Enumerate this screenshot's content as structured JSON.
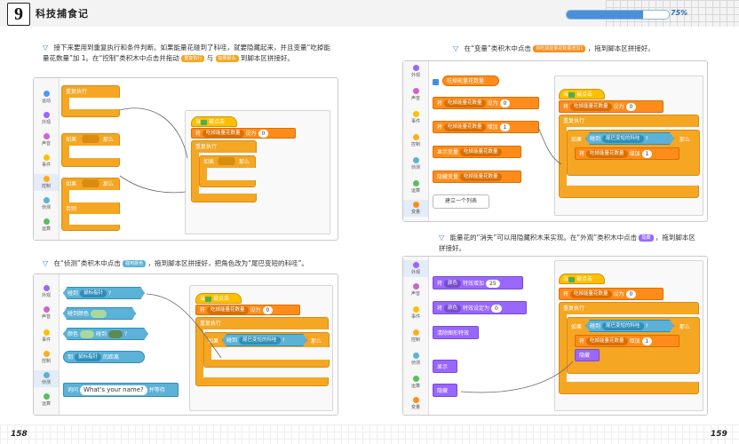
{
  "header": {
    "chapter_number": "9",
    "chapter_title": "科技捕食记",
    "progress_percent": 75,
    "progress_label": "75%"
  },
  "left_page": {
    "page_number": "158",
    "step1": {
      "text_a": "接下来要用到重复执行和条件判断。如果能量花碰到了科哇，就要隐藏起来，并且变量“吃掉能量花数量”加 1。在“控制”类积木中点击并拖动",
      "text_b": "与",
      "text_c": "到脚本区拼接好。",
      "chip1": "重复执行",
      "chip2": "如果那么"
    },
    "panel1": {
      "categories": [
        "运动",
        "外观",
        "声音",
        "事件",
        "控制",
        "侦测",
        "运算"
      ],
      "selected": "控制",
      "palette": {
        "repeat": "重复执行",
        "if": "如果",
        "then": "那么",
        "if2": "如果",
        "then2": "那么",
        "else": "否则"
      },
      "script": {
        "hat": "当",
        "hat_suffix": "被点击",
        "set_prefix": "将",
        "set_var": "吃掉能量花数量",
        "set_mid": "设为",
        "set_val": "0",
        "repeat": "重复执行",
        "if": "如果",
        "then": "那么"
      }
    },
    "step2": {
      "text_a": "在“侦测”类积木中点击",
      "chip": "碰到颜色",
      "text_b": "，拖到脚本区拼接好，把角色改为“尾巴变短的科哇”。"
    },
    "panel2": {
      "categories": [
        "外观",
        "声音",
        "事件",
        "控制",
        "侦测",
        "运算"
      ],
      "selected": "侦测",
      "palette": {
        "touching": "碰到",
        "touching_target": "鼠标指针",
        "touching_color": "碰到颜色",
        "color": "颜色",
        "color_touch": "碰到",
        "to": "到",
        "to_target": "鼠标指针",
        "distance": "的距离",
        "ask": "询问",
        "ask_text": "What's your name?",
        "ask_wait": "并等待"
      },
      "script": {
        "hat": "当",
        "hat_suffix": "被点击",
        "set_prefix": "将",
        "set_var": "吃掉能量花数量",
        "set_mid": "设为",
        "set_val": "0",
        "repeat": "重复执行",
        "if": "如果",
        "touch": "碰到",
        "touch_target": "尾巴变短的科哇",
        "then": "那么"
      }
    }
  },
  "right_page": {
    "page_number": "159",
    "step3": {
      "text_a": "在“变量”类积木中点击",
      "chip": "将吃掉能量花数量增加1",
      "text_b": "，拖到脚本区拼接好。"
    },
    "panel3": {
      "categories": [
        "外观",
        "声音",
        "事件",
        "控制",
        "侦测",
        "运算",
        "变量"
      ],
      "selected": "变量",
      "palette": {
        "var_reporter": "吃掉能量花数量",
        "set_prefix": "将",
        "set_var": "吃掉能量花数量",
        "set_mid": "设为",
        "set_val": "0",
        "change_prefix": "将",
        "change_var": "吃掉能量花数量",
        "change_mid": "增加",
        "change_val": "1",
        "show_var": "显示变量",
        "show_var_name": "吃掉能量花数量",
        "hide_var": "隐藏变量",
        "hide_var_name": "吃掉能量花数量",
        "make_list": "建立一个列表"
      },
      "script": {
        "hat": "当",
        "hat_suffix": "被点击",
        "set_prefix": "将",
        "set_var": "吃掉能量花数量",
        "set_mid": "设为",
        "set_val": "0",
        "repeat": "重复执行",
        "if": "如果",
        "touch": "碰到",
        "touch_target": "尾巴变短的科哇",
        "then": "那么",
        "change_prefix": "将",
        "change_var": "吃掉能量花数量",
        "change_mid": "增加",
        "change_val": "1"
      }
    },
    "step4": {
      "text_a": "能量花的“消失”可以用隐藏积木来实现。在“外观”类积木中点击",
      "chip": "隐藏",
      "text_b": "，拖到脚本区拼接好。"
    },
    "panel4": {
      "categories": [
        "外观",
        "声音",
        "事件",
        "控制",
        "侦测",
        "运算",
        "变量"
      ],
      "selected": "外观",
      "palette": {
        "effect_prefix": "将",
        "effect_name": "颜色",
        "effect_mid": "特效增加",
        "effect_val": "25",
        "effect2_prefix": "将",
        "effect2_name": "颜色",
        "effect2_mid": "特效设定为",
        "effect2_val": "0",
        "clear": "清除图形特效",
        "show": "显示",
        "hide": "隐藏"
      },
      "script": {
        "hat": "当",
        "hat_suffix": "被点击",
        "set_prefix": "将",
        "set_var": "吃掉能量花数量",
        "set_mid": "设为",
        "set_val": "0",
        "repeat": "重复执行",
        "if": "如果",
        "touch": "碰到",
        "touch_target": "尾巴变短的科哇",
        "then": "那么",
        "change_prefix": "将",
        "change_var": "吃掉能量花数量",
        "change_mid": "增加",
        "change_val": "1",
        "hide": "隐藏"
      }
    }
  },
  "colors": {
    "motion": "#4c97ff",
    "looks": "#9966ff",
    "sound": "#cf63cf",
    "events": "#ffbf00",
    "control": "#ffab19",
    "sensing": "#5cb1d6",
    "operators": "#59c059",
    "variables": "#ff8c1a"
  }
}
